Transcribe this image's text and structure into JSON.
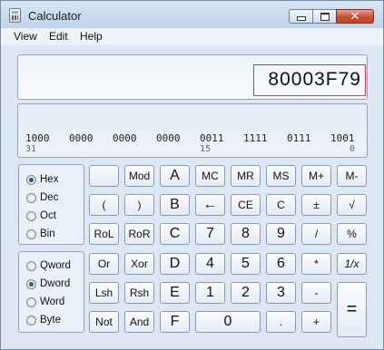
{
  "window": {
    "title": "Calculator"
  },
  "menu": [
    "View",
    "Edit",
    "Help"
  ],
  "display": {
    "value": "80003F79"
  },
  "bits": {
    "groups": [
      "1000",
      "0000",
      "0000",
      "0000",
      "0011",
      "1111",
      "0111",
      "1001"
    ],
    "positions": [
      "31",
      "15",
      "0"
    ]
  },
  "base_radios": [
    {
      "label": "Hex",
      "checked": true
    },
    {
      "label": "Dec",
      "checked": false
    },
    {
      "label": "Oct",
      "checked": false
    },
    {
      "label": "Bin",
      "checked": false
    }
  ],
  "word_radios": [
    {
      "label": "Qword",
      "checked": false
    },
    {
      "label": "Dword",
      "checked": true
    },
    {
      "label": "Word",
      "checked": false
    },
    {
      "label": "Byte",
      "checked": false
    }
  ],
  "keys": {
    "row1": [
      "",
      "Mod",
      "A",
      "MC",
      "MR",
      "MS",
      "M+",
      "M-"
    ],
    "row2": [
      "(",
      ")",
      "B",
      "←",
      "CE",
      "C",
      "±",
      "√"
    ],
    "row3": [
      "RoL",
      "RoR",
      "C",
      "7",
      "8",
      "9",
      "/",
      "%"
    ],
    "row4": [
      "Or",
      "Xor",
      "D",
      "4",
      "5",
      "6",
      "*",
      "1/x"
    ],
    "row5": [
      "Lsh",
      "Rsh",
      "E",
      "1",
      "2",
      "3",
      "-"
    ],
    "row6": [
      "Not",
      "And",
      "F",
      "0",
      ".",
      "+"
    ],
    "equals": "="
  }
}
